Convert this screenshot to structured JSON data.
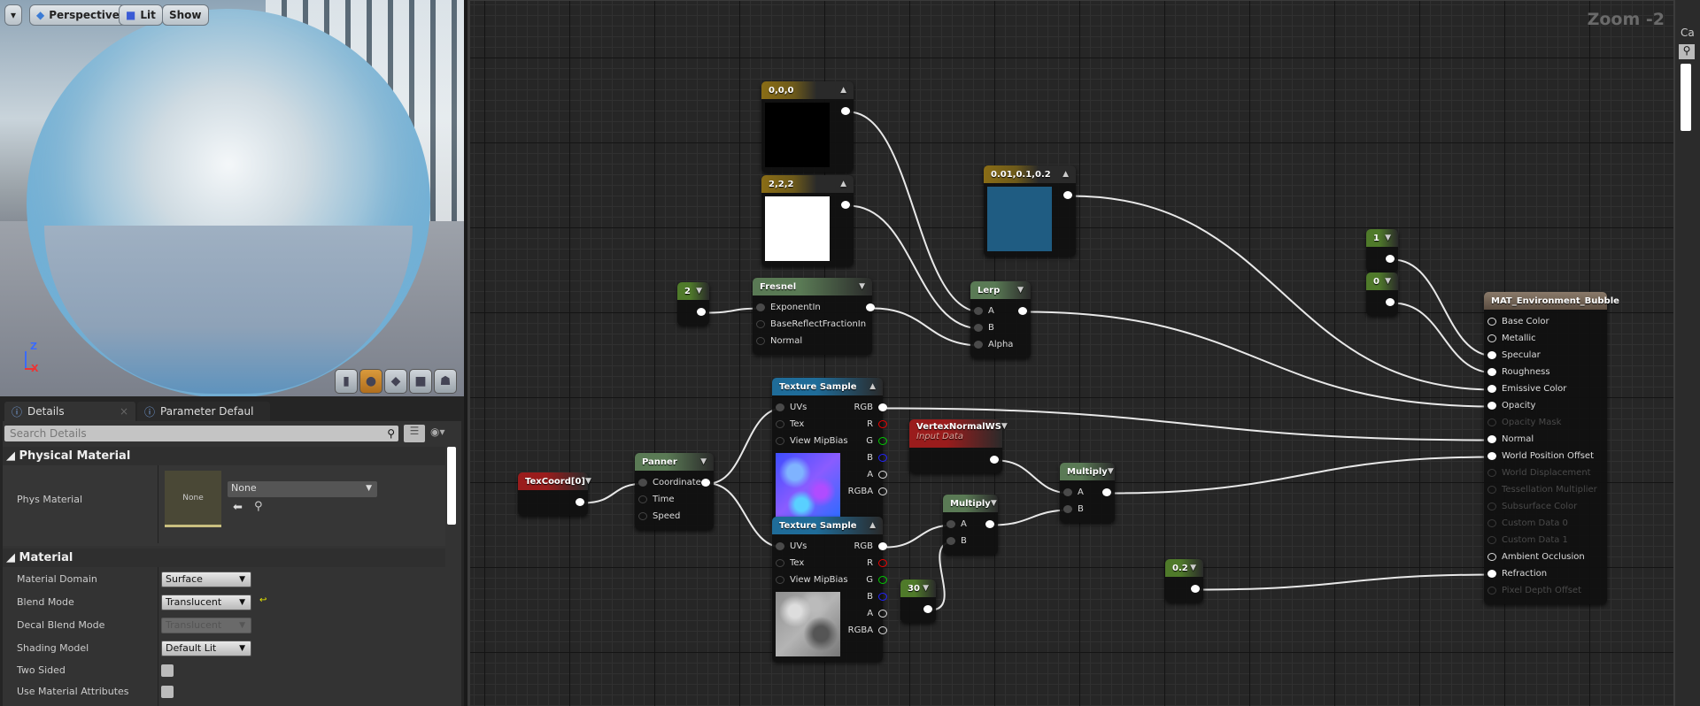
{
  "viewport": {
    "menu_icon": "chevron-down-icon",
    "perspective_label": "Perspective",
    "lit_label": "Lit",
    "show_label": "Show",
    "axis": {
      "z": "Z",
      "x": "X"
    },
    "preview_modes": [
      {
        "name": "cylinder",
        "active": false
      },
      {
        "name": "sphere",
        "active": true
      },
      {
        "name": "plane",
        "active": false
      },
      {
        "name": "cube",
        "active": false
      },
      {
        "name": "mesh",
        "active": false
      }
    ]
  },
  "details": {
    "tabs": [
      {
        "label": "Details",
        "active": true
      },
      {
        "label": "Parameter Default:",
        "active": false
      }
    ],
    "search_placeholder": "Search Details",
    "sections": {
      "physical": {
        "title": "Physical Material",
        "phys_label": "Phys Material",
        "thumb_text": "None",
        "combo_value": "None"
      },
      "material": {
        "title": "Material",
        "rows": [
          {
            "label": "Material Domain",
            "value": "Surface"
          },
          {
            "label": "Blend Mode",
            "value": "Translucent"
          },
          {
            "label": "Decal Blend Mode",
            "value": "Translucent"
          },
          {
            "label": "Shading Model",
            "value": "Default Lit"
          },
          {
            "label": "Two Sided",
            "checked": false
          },
          {
            "label": "Use Material Attributes",
            "checked": false
          }
        ]
      }
    }
  },
  "graph": {
    "zoom_label": "Zoom -2",
    "colors": {
      "constant3": "#8a6d16",
      "constant": "#4f7a2a",
      "function": "#5a7a55",
      "texture": "#1f6c99",
      "coord": "#9a1c1c",
      "result": "#6b5a4a"
    },
    "nodes": [
      {
        "id": "c000",
        "type": "constant3",
        "title": "0,0,0",
        "preview": "#000000",
        "outputs": [
          {
            "label": "",
            "state": "conn"
          }
        ]
      },
      {
        "id": "c222",
        "type": "constant3",
        "title": "2,2,2",
        "preview": "#ffffff",
        "outputs": [
          {
            "label": "",
            "state": "conn"
          }
        ]
      },
      {
        "id": "cblue",
        "type": "constant3",
        "title": "0.01,0.1,0.2",
        "preview": "#1f5c82",
        "outputs": [
          {
            "label": "",
            "state": "conn"
          }
        ]
      },
      {
        "id": "k2",
        "type": "constant",
        "title": "2",
        "outputs": [
          {
            "label": "",
            "state": "conn"
          }
        ]
      },
      {
        "id": "fresnel",
        "type": "function",
        "title": "Fresnel",
        "inputs": [
          {
            "label": "ExponentIn",
            "state": "inc"
          },
          {
            "label": "BaseReflectFractionIn",
            "state": "unc"
          },
          {
            "label": "Normal",
            "state": "unc"
          }
        ],
        "outputs": [
          {
            "label": "",
            "state": "conn"
          }
        ]
      },
      {
        "id": "lerp",
        "type": "function",
        "title": "Lerp",
        "inputs": [
          {
            "label": "A",
            "state": "inc"
          },
          {
            "label": "B",
            "state": "inc"
          },
          {
            "label": "Alpha",
            "state": "inc"
          }
        ],
        "outputs": [
          {
            "label": "",
            "state": "conn"
          }
        ]
      },
      {
        "id": "k1",
        "type": "constant",
        "title": "1",
        "outputs": [
          {
            "label": "",
            "state": "conn"
          }
        ]
      },
      {
        "id": "k0",
        "type": "constant",
        "title": "0",
        "outputs": [
          {
            "label": "",
            "state": "conn"
          }
        ]
      },
      {
        "id": "tex1",
        "type": "texture",
        "title": "Texture Sample",
        "preview": "normal-texture",
        "inputs": [
          {
            "label": "UVs",
            "state": "inc"
          },
          {
            "label": "Tex",
            "state": "unc"
          },
          {
            "label": "View MipBias",
            "state": "unc"
          }
        ],
        "outputs": [
          {
            "label": "RGB",
            "state": "conn"
          },
          {
            "label": "R",
            "state": "red"
          },
          {
            "label": "G",
            "state": "green"
          },
          {
            "label": "B",
            "state": "blue"
          },
          {
            "label": "A",
            "state": "eye"
          },
          {
            "label": "RGBA",
            "state": "eye"
          }
        ]
      },
      {
        "id": "tex2",
        "type": "texture",
        "title": "Texture Sample",
        "preview": "noise-texture",
        "inputs": [
          {
            "label": "UVs",
            "state": "inc"
          },
          {
            "label": "Tex",
            "state": "unc"
          },
          {
            "label": "View MipBias",
            "state": "unc"
          }
        ],
        "outputs": [
          {
            "label": "RGB",
            "state": "conn"
          },
          {
            "label": "R",
            "state": "red"
          },
          {
            "label": "G",
            "state": "green"
          },
          {
            "label": "B",
            "state": "blue"
          },
          {
            "label": "A",
            "state": "eye"
          },
          {
            "label": "RGBA",
            "state": "eye"
          }
        ]
      },
      {
        "id": "vnorm",
        "type": "coord",
        "title": "VertexNormalWS",
        "subtitle": "Input Data",
        "outputs": [
          {
            "label": "",
            "state": "conn"
          }
        ]
      },
      {
        "id": "texcoord",
        "type": "coord",
        "title": "TexCoord[0]",
        "outputs": [
          {
            "label": "",
            "state": "conn"
          }
        ]
      },
      {
        "id": "panner",
        "type": "function",
        "title": "Panner",
        "inputs": [
          {
            "label": "Coordinate",
            "state": "inc"
          },
          {
            "label": "Time",
            "state": "unc"
          },
          {
            "label": "Speed",
            "state": "unc"
          }
        ],
        "outputs": [
          {
            "label": "",
            "state": "conn"
          }
        ]
      },
      {
        "id": "mul1",
        "type": "function",
        "title": "Multiply",
        "inputs": [
          {
            "label": "A",
            "state": "inc"
          },
          {
            "label": "B",
            "state": "inc"
          }
        ],
        "outputs": [
          {
            "label": "",
            "state": "conn"
          }
        ]
      },
      {
        "id": "mul2",
        "type": "function",
        "title": "Multiply",
        "inputs": [
          {
            "label": "A",
            "state": "inc"
          },
          {
            "label": "B",
            "state": "inc"
          }
        ],
        "outputs": [
          {
            "label": "",
            "state": "conn"
          }
        ]
      },
      {
        "id": "k30",
        "type": "constant",
        "title": "30",
        "outputs": [
          {
            "label": "",
            "state": "conn"
          }
        ]
      },
      {
        "id": "k02",
        "type": "constant",
        "title": "0.2",
        "outputs": [
          {
            "label": "",
            "state": "conn"
          }
        ]
      },
      {
        "id": "mat",
        "type": "result",
        "title": "MAT_Environment_Bubble",
        "inputs": [
          {
            "label": "Base Color",
            "state": "eye"
          },
          {
            "label": "Metallic",
            "state": "eye"
          },
          {
            "label": "Specular",
            "state": "conn"
          },
          {
            "label": "Roughness",
            "state": "conn"
          },
          {
            "label": "Emissive Color",
            "state": "conn"
          },
          {
            "label": "Opacity",
            "state": "conn"
          },
          {
            "label": "Opacity Mask",
            "state": "dis"
          },
          {
            "label": "Normal",
            "state": "conn"
          },
          {
            "label": "World Position Offset",
            "state": "conn"
          },
          {
            "label": "World Displacement",
            "state": "dis"
          },
          {
            "label": "Tessellation Multiplier",
            "state": "dis"
          },
          {
            "label": "Subsurface Color",
            "state": "dis"
          },
          {
            "label": "Custom Data 0",
            "state": "dis"
          },
          {
            "label": "Custom Data 1",
            "state": "dis"
          },
          {
            "label": "Ambient Occlusion",
            "state": "eye"
          },
          {
            "label": "Refraction",
            "state": "conn"
          },
          {
            "label": "Pixel Depth Offset",
            "state": "dis"
          }
        ]
      }
    ],
    "connections": [
      [
        "c000",
        0,
        "lerp",
        0
      ],
      [
        "c222",
        0,
        "lerp",
        1
      ],
      [
        "k2",
        0,
        "fresnel",
        0
      ],
      [
        "fresnel",
        0,
        "lerp",
        2
      ],
      [
        "cblue",
        0,
        "mat",
        4
      ],
      [
        "lerp",
        0,
        "mat",
        5
      ],
      [
        "k1",
        0,
        "mat",
        2
      ],
      [
        "k0",
        0,
        "mat",
        3
      ],
      [
        "tex1",
        0,
        "mat",
        7
      ],
      [
        "mul2",
        0,
        "mat",
        8
      ],
      [
        "k02",
        0,
        "mat",
        15
      ],
      [
        "texcoord",
        0,
        "panner",
        0
      ],
      [
        "panner",
        0,
        "tex1",
        0
      ],
      [
        "panner",
        0,
        "tex2",
        0
      ],
      [
        "tex2",
        0,
        "mul1",
        0
      ],
      [
        "k30",
        0,
        "mul1",
        1
      ],
      [
        "mul1",
        0,
        "mul2",
        1
      ],
      [
        "vnorm",
        0,
        "mul2",
        0
      ]
    ]
  },
  "right_panel": {
    "title_fragment": "Ca"
  }
}
